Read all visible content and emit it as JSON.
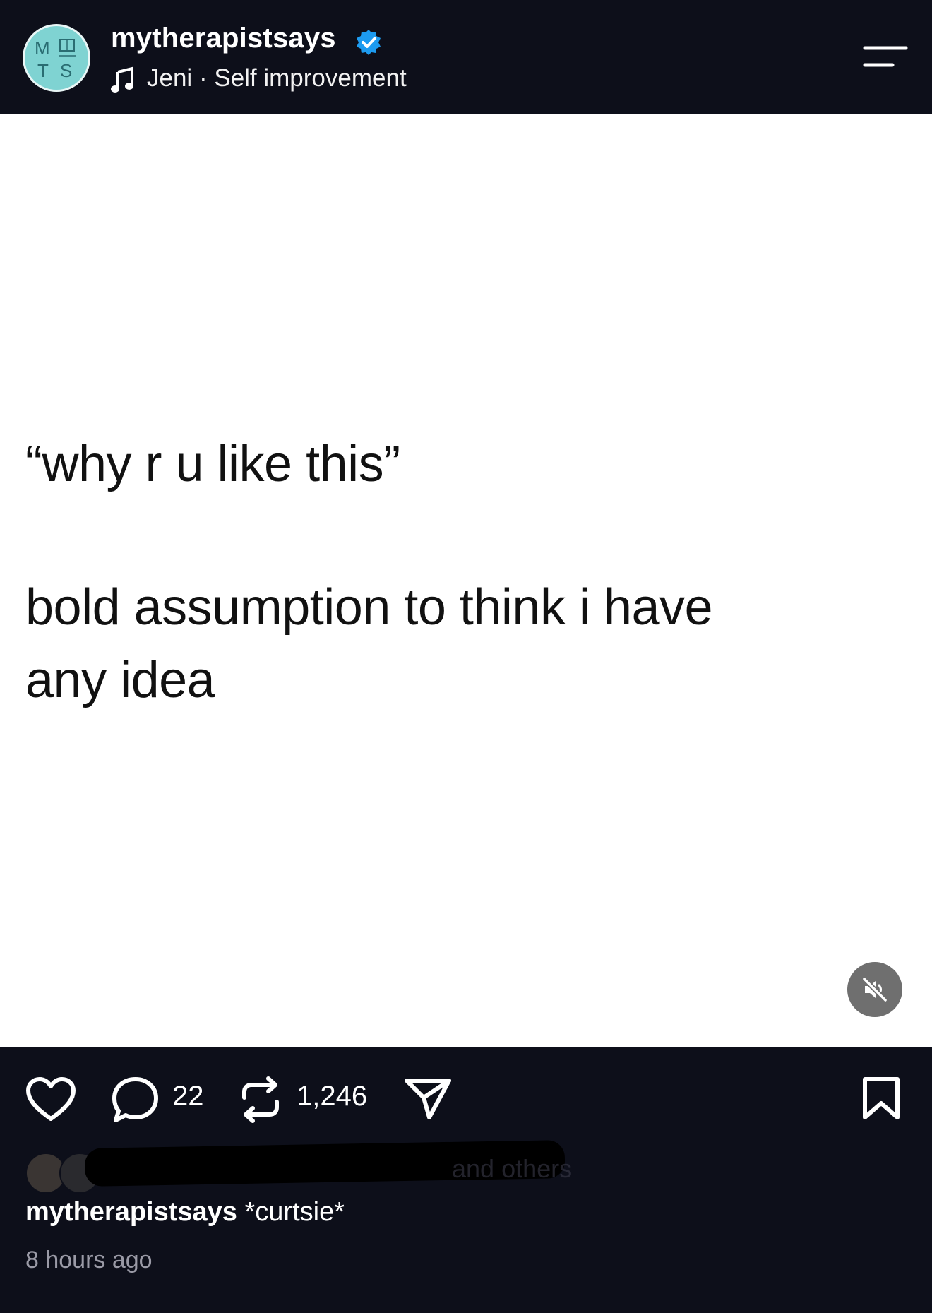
{
  "header": {
    "avatar_letters": [
      "M",
      "T",
      "S"
    ],
    "username": "mytherapistsays",
    "verified": true,
    "audio": {
      "artist": "Jeni",
      "separator": "·",
      "category": "Self improvement"
    },
    "menu_icon": "menu-icon"
  },
  "post": {
    "quote_line": "“why r u like this”",
    "answer_line1": "bold assumption to think i have",
    "answer_line2": "any idea",
    "mute_icon": "speaker-muted-icon"
  },
  "actions": {
    "like_icon": "heart-icon",
    "comment_icon": "comment-icon",
    "comment_count": "22",
    "repost_icon": "repost-icon",
    "repost_count": "1,246",
    "share_icon": "paper-plane-icon",
    "save_icon": "bookmark-icon"
  },
  "likes": {
    "text": "and others"
  },
  "caption": {
    "username": "mytherapistsays",
    "text": "*curtsie*"
  },
  "timestamp": "8 hours ago",
  "colors": {
    "background": "#0d0f1a",
    "post_background": "#ffffff",
    "verified_blue": "#1d9bf0",
    "avatar_teal": "#7fd3d2",
    "muted_text": "#9a9aa6"
  }
}
